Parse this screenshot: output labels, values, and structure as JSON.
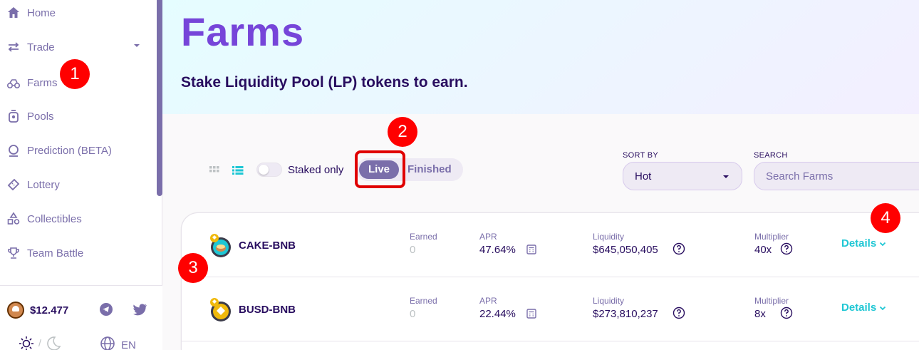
{
  "sidebar": {
    "items": [
      {
        "label": "Home",
        "icon": "home-icon"
      },
      {
        "label": "Trade",
        "icon": "trade-icon",
        "has_caret": true
      },
      {
        "label": "Farms",
        "icon": "farm-icon"
      },
      {
        "label": "Pools",
        "icon": "pool-icon"
      },
      {
        "label": "Prediction (BETA)",
        "icon": "prediction-icon"
      },
      {
        "label": "Lottery",
        "icon": "ticket-icon"
      },
      {
        "label": "Collectibles",
        "icon": "nft-icon"
      },
      {
        "label": "Team Battle",
        "icon": "trophy-icon"
      }
    ],
    "footer": {
      "cake_price": "$12.477",
      "language": "EN",
      "theme_separator": "/"
    }
  },
  "hero": {
    "title": "Farms",
    "subtitle": "Stake Liquidity Pool (LP) tokens to earn."
  },
  "controls": {
    "staked_only_label": "Staked only",
    "staked_only": false,
    "tabs": {
      "live": "Live",
      "finished": "Finished"
    },
    "sort_by_label": "SORT BY",
    "sort_value": "Hot",
    "search_label": "SEARCH",
    "search_placeholder": "Search Farms"
  },
  "farms": [
    {
      "pair": "CAKE-BNB",
      "earned_label": "Earned",
      "earned": "0",
      "apr_label": "APR",
      "apr": "47.64%",
      "liquidity_label": "Liquidity",
      "liquidity": "$645,050,405",
      "multiplier_label": "Multiplier",
      "multiplier": "40x",
      "details_label": "Details"
    },
    {
      "pair": "BUSD-BNB",
      "earned_label": "Earned",
      "earned": "0",
      "apr_label": "APR",
      "apr": "22.44%",
      "liquidity_label": "Liquidity",
      "liquidity": "$273,810,237",
      "multiplier_label": "Multiplier",
      "multiplier": "8x",
      "details_label": "Details"
    }
  ],
  "annotations": [
    "1",
    "2",
    "3",
    "4"
  ],
  "colors": {
    "primary": "#7645d9",
    "text": "#280d5f",
    "secondary": "#7a6eaa",
    "accent": "#1fc7d4",
    "annotation": "#ff0000"
  }
}
